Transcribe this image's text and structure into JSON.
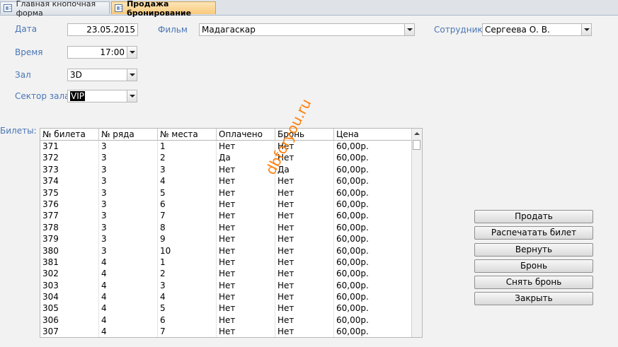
{
  "tabs": [
    {
      "label": "Главная кнопочная форма"
    },
    {
      "label": "Продажа бронирование"
    }
  ],
  "form": {
    "date_label": "Дата",
    "date_value": "23.05.2015",
    "time_label": "Время",
    "time_value": "17:00",
    "hall_label": "Зал",
    "hall_value": "3D",
    "sector_label": "Сектор зала",
    "sector_value": "VIP",
    "film_label": "Фильм",
    "film_value": "Мадагаскар",
    "employee_label": "Сотрудник",
    "employee_value": "Сергеева О. В."
  },
  "tickets": {
    "label": "Билеты:",
    "columns": [
      "№ билета",
      "№ ряда",
      "№ места",
      "Оплачено",
      "Бронь",
      "Цена"
    ],
    "rows": [
      [
        "371",
        "3",
        "1",
        "Нет",
        "Нет",
        "60,00р."
      ],
      [
        "372",
        "3",
        "2",
        "Да",
        "Нет",
        "60,00р."
      ],
      [
        "373",
        "3",
        "3",
        "Нет",
        "Да",
        "60,00р."
      ],
      [
        "374",
        "3",
        "4",
        "Нет",
        "Нет",
        "60,00р."
      ],
      [
        "375",
        "3",
        "5",
        "Нет",
        "Нет",
        "60,00р."
      ],
      [
        "376",
        "3",
        "6",
        "Нет",
        "Нет",
        "60,00р."
      ],
      [
        "377",
        "3",
        "7",
        "Нет",
        "Нет",
        "60,00р."
      ],
      [
        "378",
        "3",
        "8",
        "Нет",
        "Нет",
        "60,00р."
      ],
      [
        "379",
        "3",
        "9",
        "Нет",
        "Нет",
        "60,00р."
      ],
      [
        "380",
        "3",
        "10",
        "Нет",
        "Нет",
        "60,00р."
      ],
      [
        "381",
        "4",
        "1",
        "Нет",
        "Нет",
        "60,00р."
      ],
      [
        "302",
        "4",
        "2",
        "Нет",
        "Нет",
        "60,00р."
      ],
      [
        "303",
        "4",
        "3",
        "Нет",
        "Нет",
        "60,00р."
      ],
      [
        "304",
        "4",
        "4",
        "Нет",
        "Нет",
        "60,00р."
      ],
      [
        "305",
        "4",
        "5",
        "Нет",
        "Нет",
        "60,00р."
      ],
      [
        "306",
        "4",
        "6",
        "Нет",
        "Нет",
        "60,00р."
      ],
      [
        "307",
        "4",
        "7",
        "Нет",
        "Нет",
        "60,00р."
      ]
    ]
  },
  "buttons": {
    "sell": "Продать",
    "print": "Распечатать билет",
    "return": "Вернуть",
    "reserve": "Бронь",
    "unreserve": "Снять бронь",
    "close": "Закрыть"
  },
  "watermark": "dbforyou.ru"
}
